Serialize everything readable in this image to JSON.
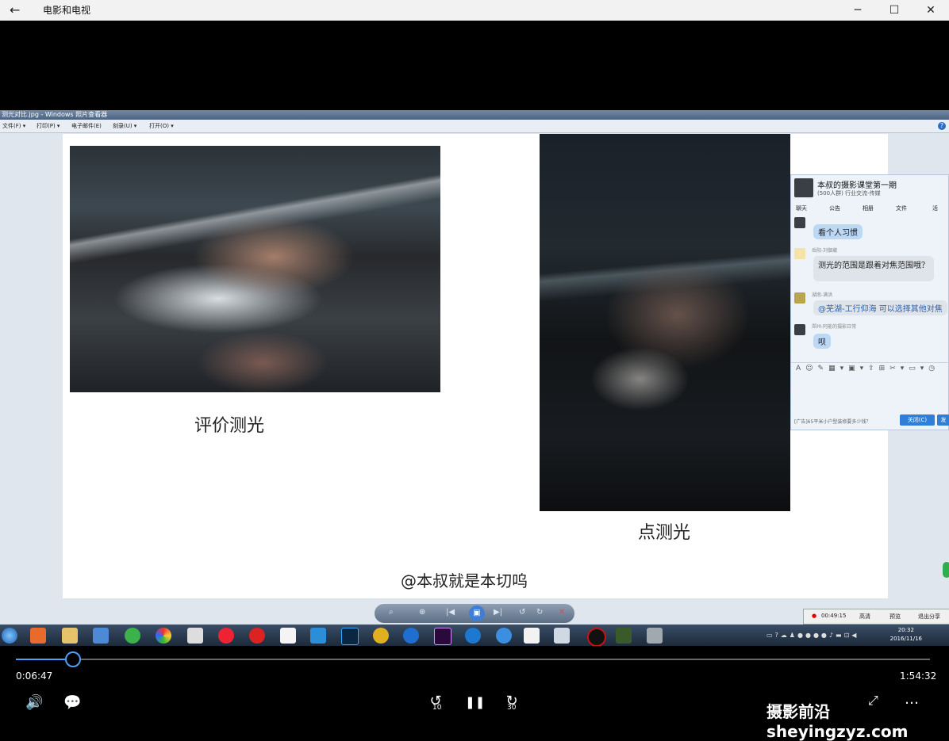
{
  "window": {
    "title": "电影和电视",
    "minimize": "─",
    "maximize": "☐",
    "close": "✕"
  },
  "viewer": {
    "title": "测光对比.jpg - Windows 照片查看器",
    "menu": [
      "文件(F) ▾",
      "打印(P) ▾",
      "电子邮件(E)",
      "刻录(U) ▾",
      "打开(O) ▾"
    ],
    "help": "?"
  },
  "slide": {
    "caption_left": "评价测光",
    "caption_right": "点测光",
    "watermark": "@本叔就是本切呜"
  },
  "chat": {
    "group_name": "本叔的摄影课堂第一期",
    "group_info": "(500人群) 行业交流-传媒",
    "tabs": [
      "聊天",
      "公告",
      "相册",
      "文件",
      "活"
    ],
    "messages": [
      {
        "sender": "",
        "text": "看个人习惯"
      },
      {
        "sender": "岳阳-刘御葳",
        "text": "测光的范围是跟着对焦范围哦？"
      },
      {
        "sender": "湖南-满洪",
        "text": "@芜湖-工行仰海 可以选择其他对焦"
      },
      {
        "sender": "郑州-阿能的摄影日常",
        "text": "呗"
      }
    ],
    "ad": "[广告]65平米小户型装修要多少钱？",
    "close_btn": "关闭(C)",
    "send_btn": "发"
  },
  "player_toolbar": [
    "⌕",
    "⊕",
    "|◀",
    "▣",
    "▶|",
    "↺",
    "↻",
    "✕"
  ],
  "recording": {
    "time": "00:49:15",
    "quality": "高清",
    "preview": "预览",
    "exit": "退出分享"
  },
  "clock": {
    "time": "20:32",
    "date": "2016/11/16"
  },
  "playback": {
    "elapsed": "0:06:47",
    "total": "1:54:32",
    "progress": 0.063
  },
  "controls": {
    "volume_icon": "🔊",
    "subtitle_icon": "💬",
    "rewind_label": "10",
    "pause_icon": "❚❚",
    "forward_label": "30",
    "expand_icon": "⤢",
    "more_icon": "…"
  },
  "site_watermark": "摄影前沿 sheyingzyz.com"
}
